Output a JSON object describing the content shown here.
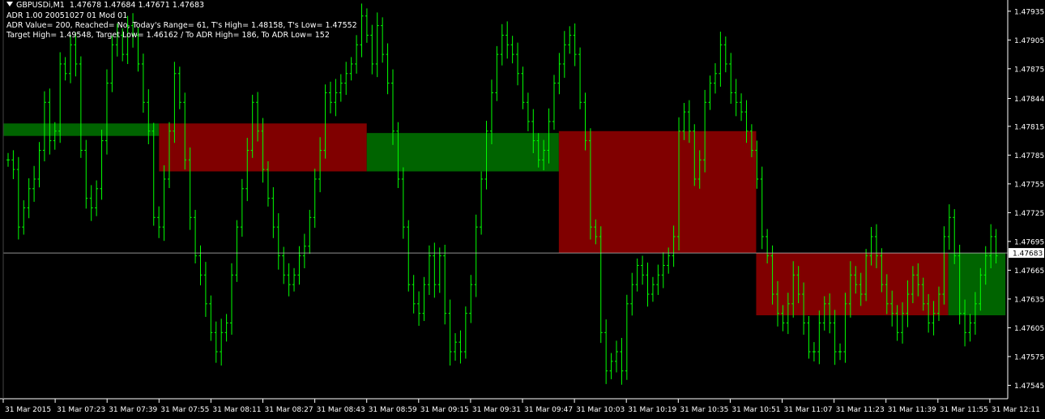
{
  "header": {
    "symbol": "GBPUSDi,M1",
    "ohlc": "1.47678 1.47684 1.47671 1.47683",
    "info_lines": [
      "ADR 1.00 20051027 01 Mod 01",
      "ADR Value= 200, Reached= No, Today's Range= 61, T's High= 1.48158, T's Low= 1.47552",
      "Target High= 1.49548, Target Low= 1.46162 / To ADR High= 186, To ADR Low= 152"
    ]
  },
  "colors": {
    "background": "#000000",
    "candle": "#00ff00",
    "bull_zone": "#006400",
    "bear_zone": "#800000",
    "bear_spike": "#8b0000",
    "grid_text": "#ffffff",
    "price_line": "#c0c0c0"
  },
  "chart_data": {
    "type": "bar",
    "title": "",
    "y_axis": {
      "range": [
        1.47531,
        1.47945
      ],
      "ticks": [
        "1.47935",
        "1.47905",
        "1.47875",
        "1.47844",
        "1.47815",
        "1.47785",
        "1.47755",
        "1.47725",
        "1.47695",
        "1.47665",
        "1.47635",
        "1.47605",
        "1.47575",
        "1.47545"
      ],
      "current_price": "1.47683"
    },
    "x_axis": {
      "ticks": [
        "31 Mar 2015",
        "31 Mar 07:23",
        "31 Mar 07:39",
        "31 Mar 07:55",
        "31 Mar 08:11",
        "31 Mar 08:27",
        "31 Mar 08:43",
        "31 Mar 08:59",
        "31 Mar 09:15",
        "31 Mar 09:31",
        "31 Mar 09:47",
        "31 Mar 10:03",
        "31 Mar 10:19",
        "31 Mar 10:35",
        "31 Mar 10:51",
        "31 Mar 11:07",
        "31 Mar 11:23",
        "31 Mar 11:39",
        "31 Mar 11:55",
        "31 Mar 12:11"
      ]
    },
    "zones": [
      {
        "type": "bull",
        "from_tick": 0,
        "to_tick": 3,
        "high": 1.47818,
        "low": 1.47805
      },
      {
        "type": "bear",
        "from_tick": 3,
        "to_tick": 7,
        "high": 1.47818,
        "low": 1.47768
      },
      {
        "type": "bull",
        "from_tick": 7,
        "to_tick": 10.7,
        "high": 1.47808,
        "low": 1.47768
      },
      {
        "type": "bear",
        "from_tick": 10.7,
        "to_tick": 14.5,
        "high": 1.4781,
        "low": 1.47683
      },
      {
        "type": "bear",
        "from_tick": 14.5,
        "to_tick": 18.2,
        "high": 1.47683,
        "low": 1.47618
      },
      {
        "type": "bull",
        "from_tick": 18.2,
        "to_tick": 19.3,
        "high": 1.47683,
        "low": 1.47618
      }
    ],
    "series": [
      {
        "values": [
          1.4778,
          1.4777,
          1.4771,
          1.4773,
          1.4775,
          1.4776,
          1.4779,
          1.4784,
          1.478,
          1.4781,
          1.4788,
          1.4787,
          1.479,
          1.4788,
          1.4779,
          1.4774,
          1.4773,
          1.4775,
          1.478,
          1.4786,
          1.479,
          1.4791,
          1.4789,
          1.4792,
          1.4791,
          1.4788,
          1.4784,
          1.4781,
          1.4772,
          1.4771,
          1.4776,
          1.4781,
          1.4787,
          1.4784,
          1.4778,
          1.4772,
          1.4768,
          1.4766,
          1.4763,
          1.476,
          1.4758,
          1.476,
          1.4761,
          1.4766,
          1.4771,
          1.4775,
          1.4779,
          1.4784,
          1.4781,
          1.4777,
          1.4774,
          1.4771,
          1.4768,
          1.4766,
          1.4765,
          1.4766,
          1.4768,
          1.4769,
          1.4772,
          1.4776,
          1.4779,
          1.4785,
          1.4784,
          1.4785,
          1.4786,
          1.4787,
          1.4788,
          1.479,
          1.4793,
          1.4791,
          1.4788,
          1.4792,
          1.4789,
          1.4786,
          1.4781,
          1.4776,
          1.4771,
          1.4765,
          1.4763,
          1.4762,
          1.4765,
          1.4768,
          1.4765,
          1.4768,
          1.4762,
          1.4758,
          1.4759,
          1.4758,
          1.4762,
          1.4765,
          1.4771,
          1.4776,
          1.4781,
          1.4785,
          1.4789,
          1.4791,
          1.479,
          1.4789,
          1.4787,
          1.4784,
          1.4782,
          1.478,
          1.4778,
          1.4779,
          1.4782,
          1.4786,
          1.4788,
          1.479,
          1.4791,
          1.4789,
          1.4784,
          1.478,
          1.4771,
          1.477,
          1.476,
          1.4756,
          1.4757,
          1.4758,
          1.4756,
          1.4763,
          1.4765,
          1.4767,
          1.4766,
          1.4764,
          1.4765,
          1.4766,
          1.4767,
          1.4768,
          1.477,
          1.4781,
          1.4783,
          1.4781,
          1.4776,
          1.4778,
          1.4784,
          1.4786,
          1.4787,
          1.479,
          1.4788,
          1.4785,
          1.4784,
          1.4783,
          1.4781,
          1.4779,
          1.4776,
          1.477,
          1.4768,
          1.4764,
          1.4762,
          1.4761,
          1.4763,
          1.4766,
          1.4764,
          1.4761,
          1.4758,
          1.4758,
          1.4761,
          1.4763,
          1.4761,
          1.4758,
          1.4758,
          1.4763,
          1.4766,
          1.4765,
          1.4764,
          1.4768,
          1.477,
          1.4768,
          1.4765,
          1.4763,
          1.4762,
          1.476,
          1.4762,
          1.4764,
          1.4766,
          1.4765,
          1.4763,
          1.4761,
          1.4762,
          1.4764,
          1.477,
          1.4772,
          1.4768,
          1.4762,
          1.476,
          1.4761,
          1.4763,
          1.4766,
          1.4768,
          1.477,
          1.4768
        ]
      }
    ]
  }
}
